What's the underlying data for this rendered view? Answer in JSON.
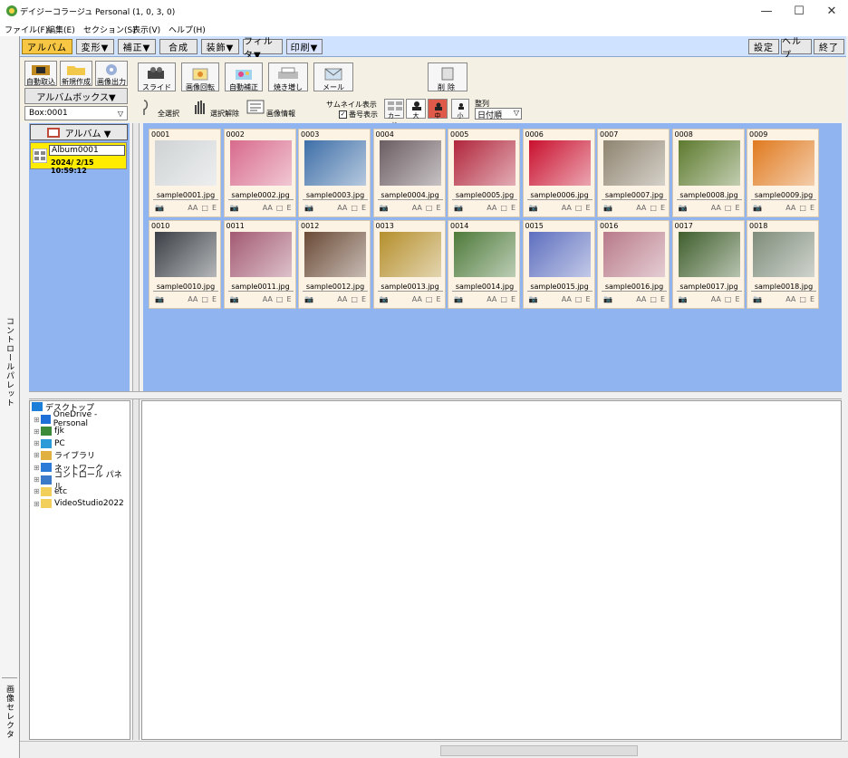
{
  "window": {
    "title": "デイジーコラージュ Personal (1, 0, 3, 0)"
  },
  "menu": [
    {
      "label": "ファイル(F)"
    },
    {
      "label": "編集(E)"
    },
    {
      "label": "セクション(S)"
    },
    {
      "label": "表示(V)"
    },
    {
      "label": "ヘルプ(H)"
    }
  ],
  "tabs": [
    "アルバム",
    "変形▼",
    "補正▼",
    "合成",
    "装飾▼",
    "フィルタ▼",
    "印刷▼"
  ],
  "right_tabs": [
    "設定",
    "ヘルプ",
    "終了"
  ],
  "side_tabs": {
    "top": "コントロールパレット",
    "bottom": "画像セレクタ"
  },
  "left_tools": {
    "import": "自動取込",
    "new": "新規作成",
    "export": "画像出力",
    "album_box": "アルバムボックス▼",
    "box_select": "Box:0001",
    "dropdown_arrow": "▽"
  },
  "toolbar": {
    "buttons": [
      "スライド",
      "画像回転",
      "自動補正",
      "焼き増し",
      "メール",
      "削除"
    ],
    "select_all": "全選択",
    "deselect": "選択解除",
    "info": "画像情報",
    "thumb_label": "サムネイル表示",
    "show_number": "番号表示",
    "card": "カード",
    "large": "大",
    "medium": "中",
    "small": "小",
    "sort_label": "整列",
    "sort_value": "日付順",
    "sort_arrow": "▽"
  },
  "album_pane": {
    "header": "アルバム ▼",
    "card_name": "Album0001",
    "card_date": "2024/ 2/15 10:59:12"
  },
  "thumb_meta": {
    "aa": "AA",
    "box": "□",
    "e": "E"
  },
  "thumbnails": [
    {
      "num": "0001",
      "file": "sample0001.jpg",
      "color": "#cfd3d4"
    },
    {
      "num": "0002",
      "file": "sample0002.jpg",
      "color": "#d86a8c"
    },
    {
      "num": "0003",
      "file": "sample0003.jpg",
      "color": "#3e6fa8"
    },
    {
      "num": "0004",
      "file": "sample0004.jpg",
      "color": "#6b5d62"
    },
    {
      "num": "0005",
      "file": "sample0005.jpg",
      "color": "#b1253b"
    },
    {
      "num": "0006",
      "file": "sample0006.jpg",
      "color": "#c9102e"
    },
    {
      "num": "0007",
      "file": "sample0007.jpg",
      "color": "#8f8470"
    },
    {
      "num": "0008",
      "file": "sample0008.jpg",
      "color": "#5d7a2e"
    },
    {
      "num": "0009",
      "file": "sample0009.jpg",
      "color": "#e07a1f"
    },
    {
      "num": "0010",
      "file": "sample0010.jpg",
      "color": "#3a3f45"
    },
    {
      "num": "0011",
      "file": "sample0011.jpg",
      "color": "#a35a72"
    },
    {
      "num": "0012",
      "file": "sample0012.jpg",
      "color": "#6a4a36"
    },
    {
      "num": "0013",
      "file": "sample0013.jpg",
      "color": "#b58f2c"
    },
    {
      "num": "0014",
      "file": "sample0014.jpg",
      "color": "#4e7a3a"
    },
    {
      "num": "0015",
      "file": "sample0015.jpg",
      "color": "#5e6fbf"
    },
    {
      "num": "0016",
      "file": "sample0016.jpg",
      "color": "#b87a8a"
    },
    {
      "num": "0017",
      "file": "sample0017.jpg",
      "color": "#3f5e2c"
    },
    {
      "num": "0018",
      "file": "sample0018.jpg",
      "color": "#7f8c7a"
    }
  ],
  "tree": [
    {
      "label": "デスクトップ",
      "icon": "desktop-icon",
      "color": "#1e7fd8"
    },
    {
      "label": "OneDrive - Personal",
      "icon": "cloud-icon",
      "color": "#1e6fd8"
    },
    {
      "label": "fjk",
      "icon": "user-icon",
      "color": "#3a8a3a"
    },
    {
      "label": "PC",
      "icon": "computer-icon",
      "color": "#2b9ad8"
    },
    {
      "label": "ライブラリ",
      "icon": "library-icon",
      "color": "#e0b040"
    },
    {
      "label": "ネットワーク",
      "icon": "network-icon",
      "color": "#2b7ad8"
    },
    {
      "label": "コントロール パネル",
      "icon": "control-panel-icon",
      "color": "#3a7ac8"
    },
    {
      "label": "etc",
      "icon": "folder-icon",
      "color": "#f2cf5a"
    },
    {
      "label": "VideoStudio2022",
      "icon": "folder-icon",
      "color": "#f2cf5a"
    }
  ]
}
